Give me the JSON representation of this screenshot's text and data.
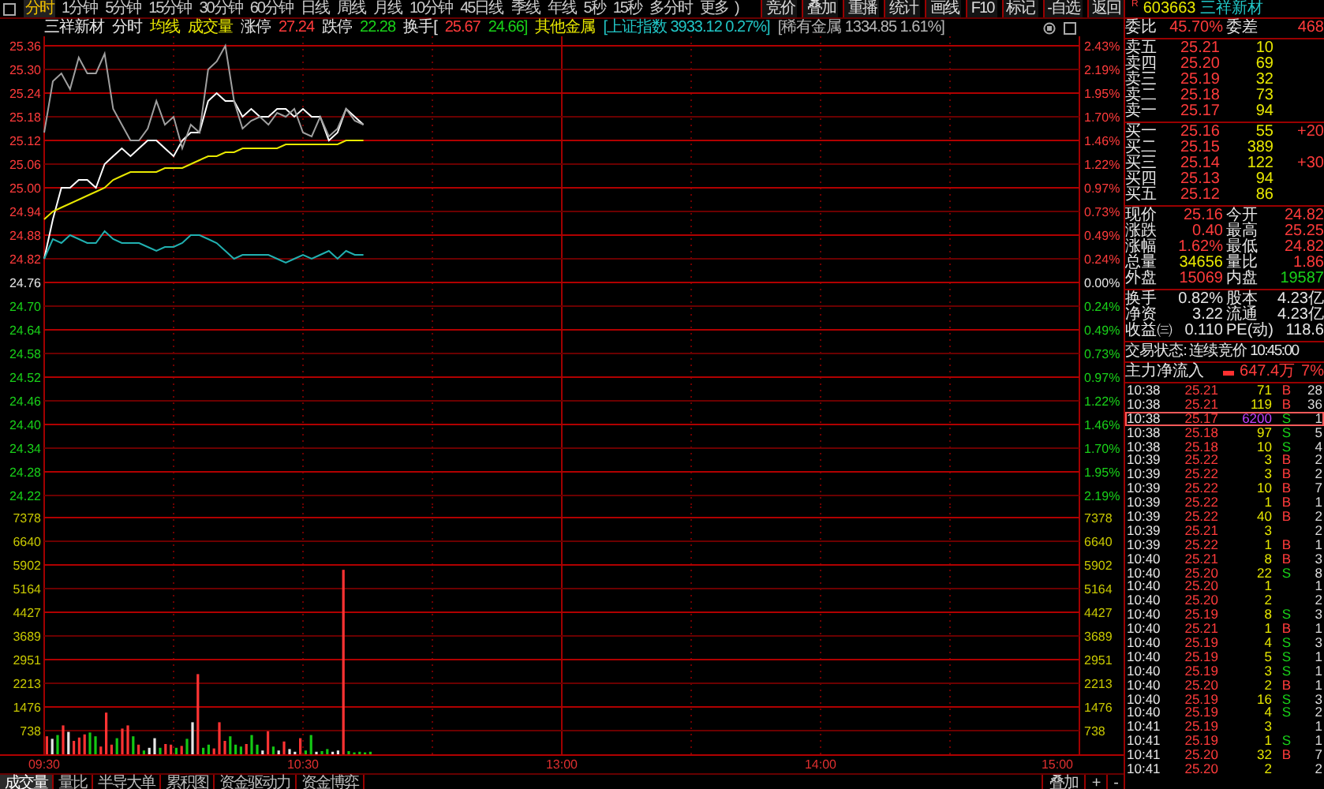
{
  "toolbar": {
    "periods": [
      {
        "label": "分时",
        "selected": true
      },
      {
        "label": "1分钟",
        "selected": false
      },
      {
        "label": "5分钟",
        "selected": false
      },
      {
        "label": "15分钟",
        "selected": false
      },
      {
        "label": "30分钟",
        "selected": false
      },
      {
        "label": "60分钟",
        "selected": false
      },
      {
        "label": "日线",
        "selected": false
      },
      {
        "label": "周线",
        "selected": false
      },
      {
        "label": "月线",
        "selected": false
      },
      {
        "label": "10分钟",
        "selected": false
      },
      {
        "label": "45日线",
        "selected": false
      },
      {
        "label": "季线",
        "selected": false
      },
      {
        "label": "年线",
        "selected": false
      },
      {
        "label": "5秒",
        "selected": false
      },
      {
        "label": "15秒",
        "selected": false
      },
      {
        "label": "多分时",
        "selected": false
      },
      {
        "label": "更多",
        "selected": false
      }
    ],
    "trailing": ")",
    "tools": [
      "竞价",
      "叠加",
      "重播",
      "统计",
      "画线",
      "F10",
      "标记",
      "-自选",
      "返回"
    ]
  },
  "info_bar": {
    "items": [
      {
        "text": "三祥新材",
        "color": "#e6e6e6"
      },
      {
        "text": "分时",
        "color": "#e6e6e6"
      },
      {
        "text": "均线",
        "color": "#e8e800"
      },
      {
        "text": "成交量",
        "color": "#e8e800"
      },
      {
        "text": "涨停",
        "color": "#e6e6e6"
      },
      {
        "text": "27.24",
        "color": "#ff3b3b"
      },
      {
        "text": "跌停",
        "color": "#e6e6e6"
      },
      {
        "text": "22.28",
        "color": "#19d219"
      },
      {
        "text": "换手[",
        "color": "#e6e6e6"
      },
      {
        "text": "25.67",
        "color": "#ff3b3b"
      },
      {
        "text": "24.66]",
        "color": "#19d219"
      },
      {
        "text": "其他金属",
        "color": "#e8e800"
      },
      {
        "text": "[上证指数 3933.12 0.27%]",
        "color": "#21c6c6"
      },
      {
        "text": "[稀有金属 1334.85 1.61%]",
        "color": "#b4b4b4"
      }
    ]
  },
  "price_panel": {
    "right_axis": [
      {
        "text": "2.43%",
        "color": "#ff3b3b"
      },
      {
        "text": "2.19%",
        "color": "#ff3b3b"
      },
      {
        "text": "1.95%",
        "color": "#ff3b3b"
      },
      {
        "text": "1.70%",
        "color": "#ff3b3b"
      },
      {
        "text": "1.46%",
        "color": "#ff3b3b"
      },
      {
        "text": "1.22%",
        "color": "#ff3b3b"
      },
      {
        "text": "0.97%",
        "color": "#ff3b3b"
      },
      {
        "text": "0.73%",
        "color": "#ff3b3b"
      },
      {
        "text": "0.49%",
        "color": "#ff3b3b"
      },
      {
        "text": "0.24%",
        "color": "#ff3b3b"
      },
      {
        "text": "0.00%",
        "color": "#e6e6e6"
      },
      {
        "text": "0.24%",
        "color": "#19d219"
      },
      {
        "text": "0.49%",
        "color": "#19d219"
      },
      {
        "text": "0.73%",
        "color": "#19d219"
      },
      {
        "text": "0.97%",
        "color": "#19d219"
      },
      {
        "text": "1.22%",
        "color": "#19d219"
      },
      {
        "text": "1.46%",
        "color": "#19d219"
      },
      {
        "text": "1.70%",
        "color": "#19d219"
      },
      {
        "text": "1.95%",
        "color": "#19d219"
      },
      {
        "text": "2.19%",
        "color": "#19d219"
      }
    ],
    "chart_data": {
      "type": "line",
      "grid": true,
      "ylim": [
        24.22,
        25.36
      ],
      "yticks": [
        {
          "value": 25.36,
          "label": "25.36"
        },
        {
          "value": 25.3,
          "label": "25.30"
        },
        {
          "value": 25.24,
          "label": "25.24"
        },
        {
          "value": 25.18,
          "label": "25.18"
        },
        {
          "value": 25.12,
          "label": "25.12"
        },
        {
          "value": 25.06,
          "label": "25.06"
        },
        {
          "value": 25.0,
          "label": "25.00"
        },
        {
          "value": 24.94,
          "label": "24.94"
        },
        {
          "value": 24.88,
          "label": "24.88"
        },
        {
          "value": 24.82,
          "label": "24.82"
        },
        {
          "value": 24.76,
          "label": "24.76"
        },
        {
          "value": 24.7,
          "label": "24.70"
        },
        {
          "value": 24.64,
          "label": "24.64"
        },
        {
          "value": 24.58,
          "label": "24.58"
        },
        {
          "value": 24.52,
          "label": "24.52"
        },
        {
          "value": 24.46,
          "label": "24.46"
        },
        {
          "value": 24.4,
          "label": "24.40"
        },
        {
          "value": 24.34,
          "label": "24.34"
        },
        {
          "value": 24.28,
          "label": "24.28"
        },
        {
          "value": 24.22,
          "label": "24.22"
        }
      ],
      "categories": [
        null,
        null,
        null,
        null,
        null,
        null,
        null,
        null,
        null,
        null,
        null,
        null,
        null,
        null,
        null,
        null,
        null,
        null,
        null,
        null,
        null,
        null,
        null,
        null,
        null,
        null,
        null,
        null,
        null,
        null,
        null,
        null,
        null,
        null,
        null,
        null,
        null,
        null,
        null,
        null,
        null,
        null,
        null,
        null,
        null,
        null,
        null,
        null,
        null,
        null,
        null,
        null,
        null,
        null,
        null,
        null,
        null,
        null,
        null,
        null,
        null,
        null,
        null,
        null,
        null,
        null,
        null,
        null,
        null,
        null,
        null,
        null,
        null,
        null,
        null,
        null,
        null,
        null,
        null,
        null,
        null,
        null,
        null,
        null,
        null,
        null,
        null,
        null,
        null,
        null,
        null,
        null,
        null,
        null,
        null,
        null,
        null,
        null,
        null,
        null,
        null,
        null,
        null,
        null,
        null,
        null,
        null,
        null,
        null,
        null,
        null,
        null,
        null,
        null,
        null,
        null,
        null,
        null,
        null,
        null,
        null
      ],
      "series": [
        {
          "color": "#ffffff",
          "values": [
            24.82,
            24.92,
            25.0,
            25.0,
            25.02,
            25.02,
            25.0,
            25.06,
            25.08,
            25.1,
            25.08,
            25.1,
            25.12,
            25.12,
            25.1,
            25.08,
            25.12,
            25.14,
            25.14,
            25.22,
            25.24,
            25.22,
            25.22,
            25.18,
            25.2,
            25.18,
            25.18,
            25.2,
            25.2,
            25.18,
            25.2,
            25.18,
            25.18,
            25.12,
            25.14,
            25.2,
            25.18,
            25.16,
            null,
            null,
            null,
            null,
            null,
            null,
            null,
            null,
            null,
            null,
            null,
            null,
            null,
            null,
            null,
            null,
            null,
            null,
            null,
            null,
            null,
            null,
            null,
            null,
            null,
            null,
            null,
            null,
            null,
            null,
            null,
            null,
            null,
            null,
            null,
            null,
            null,
            null,
            null,
            null,
            null,
            null,
            null,
            null,
            null,
            null,
            null,
            null,
            null,
            null,
            null,
            null,
            null,
            null,
            null,
            null,
            null,
            null,
            null,
            null,
            null,
            null,
            null,
            null,
            null,
            null,
            null,
            null,
            null,
            null,
            null,
            null,
            null,
            null,
            null,
            null,
            null,
            null,
            null,
            null,
            null,
            null,
            null
          ]
        },
        {
          "color": "#e8e800",
          "values": [
            24.92,
            24.94,
            24.95,
            24.96,
            24.97,
            24.98,
            24.99,
            25.0,
            25.02,
            25.03,
            25.04,
            25.04,
            25.04,
            25.04,
            25.05,
            25.05,
            25.05,
            25.06,
            25.07,
            25.08,
            25.08,
            25.09,
            25.09,
            25.1,
            25.1,
            25.1,
            25.1,
            25.1,
            25.11,
            25.11,
            25.11,
            25.11,
            25.11,
            25.11,
            25.11,
            25.12,
            25.12,
            25.12,
            null,
            null,
            null,
            null,
            null,
            null,
            null,
            null,
            null,
            null,
            null,
            null,
            null,
            null,
            null,
            null,
            null,
            null,
            null,
            null,
            null,
            null,
            null,
            null,
            null,
            null,
            null,
            null,
            null,
            null,
            null,
            null,
            null,
            null,
            null,
            null,
            null,
            null,
            null,
            null,
            null,
            null,
            null,
            null,
            null,
            null,
            null,
            null,
            null,
            null,
            null,
            null,
            null,
            null,
            null,
            null,
            null,
            null,
            null,
            null,
            null,
            null,
            null,
            null,
            null,
            null,
            null,
            null,
            null,
            null,
            null,
            null,
            null,
            null,
            null,
            null,
            null,
            null,
            null,
            null,
            null,
            null,
            null
          ]
        },
        {
          "color": "#a0a0a0",
          "values": [
            25.14,
            25.27,
            25.29,
            25.25,
            25.33,
            25.29,
            25.29,
            25.34,
            25.2,
            25.16,
            25.12,
            25.12,
            25.15,
            25.22,
            25.16,
            25.18,
            25.1,
            25.16,
            25.14,
            25.3,
            25.32,
            25.36,
            25.22,
            25.15,
            25.17,
            25.18,
            25.16,
            25.19,
            25.18,
            25.2,
            25.14,
            25.13,
            25.18,
            25.13,
            25.15,
            25.2,
            25.17,
            25.16,
            null,
            null,
            null,
            null,
            null,
            null,
            null,
            null,
            null,
            null,
            null,
            null,
            null,
            null,
            null,
            null,
            null,
            null,
            null,
            null,
            null,
            null,
            null,
            null,
            null,
            null,
            null,
            null,
            null,
            null,
            null,
            null,
            null,
            null,
            null,
            null,
            null,
            null,
            null,
            null,
            null,
            null,
            null,
            null,
            null,
            null,
            null,
            null,
            null,
            null,
            null,
            null,
            null,
            null,
            null,
            null,
            null,
            null,
            null,
            null,
            null,
            null,
            null,
            null,
            null,
            null,
            null,
            null,
            null,
            null,
            null,
            null,
            null,
            null,
            null,
            null,
            null,
            null,
            null,
            null,
            null,
            null,
            null
          ]
        },
        {
          "color": "#21b0b0",
          "values": [
            24.82,
            24.87,
            24.86,
            24.88,
            24.87,
            24.86,
            24.86,
            24.89,
            24.87,
            24.86,
            24.86,
            24.86,
            24.85,
            24.84,
            24.85,
            24.85,
            24.86,
            24.88,
            24.88,
            24.87,
            24.86,
            24.84,
            24.82,
            24.83,
            24.83,
            24.83,
            24.83,
            24.82,
            24.81,
            24.82,
            24.83,
            24.82,
            24.83,
            24.84,
            24.82,
            24.84,
            24.83,
            24.83,
            null,
            null,
            null,
            null,
            null,
            null,
            null,
            null,
            null,
            null,
            null,
            null,
            null,
            null,
            null,
            null,
            null,
            null,
            null,
            null,
            null,
            null,
            null,
            null,
            null,
            null,
            null,
            null,
            null,
            null,
            null,
            null,
            null,
            null,
            null,
            null,
            null,
            null,
            null,
            null,
            null,
            null,
            null,
            null,
            null,
            null,
            null,
            null,
            null,
            null,
            null,
            null,
            null,
            null,
            null,
            null,
            null,
            null,
            null,
            null,
            null,
            null,
            null,
            null,
            null,
            null,
            null,
            null,
            null,
            null,
            null,
            null,
            null,
            null,
            null,
            null,
            null,
            null,
            null,
            null,
            null,
            null,
            null
          ]
        }
      ]
    }
  },
  "volume_panel": {
    "time_labels": [
      "09:30",
      "10:30",
      "13:00",
      "14:00",
      "15:00"
    ],
    "right_axis": [
      "7378",
      "6640",
      "5902",
      "5164",
      "4427",
      "3689",
      "2951",
      "2213",
      "1476",
      "738"
    ],
    "chart_data": {
      "type": "bar",
      "grid": true,
      "ylim": [
        0,
        7378
      ],
      "yticks": [
        7378,
        6640,
        5902,
        5164,
        4427,
        3689,
        2951,
        2213,
        1476,
        738
      ],
      "categories": [
        null,
        null,
        null,
        null,
        null,
        null,
        null,
        null,
        null,
        null,
        null,
        null,
        null,
        null,
        null,
        null,
        null,
        null,
        null,
        null,
        null,
        null,
        null,
        null,
        null,
        null,
        null,
        null,
        null,
        null,
        null,
        null,
        null,
        null,
        null,
        null,
        null,
        null,
        null,
        null,
        null,
        null,
        null,
        null,
        null,
        null,
        null,
        null,
        null,
        null,
        null,
        null,
        null,
        null,
        null,
        null,
        null,
        null,
        null,
        null,
        null,
        null,
        null,
        null,
        null,
        null,
        null,
        null,
        null,
        null,
        null,
        null,
        null,
        null,
        null,
        null,
        null,
        null,
        null,
        null,
        null,
        null,
        null,
        null,
        null,
        null,
        null,
        null,
        null,
        null,
        null,
        null,
        null,
        null,
        null,
        null,
        null,
        null,
        null,
        null,
        null,
        null,
        null,
        null,
        null,
        null,
        null,
        null,
        null,
        null,
        null,
        null,
        null,
        null,
        null,
        null,
        null,
        null,
        null,
        null,
        null,
        null,
        null,
        null,
        null,
        null,
        null,
        null,
        null,
        null,
        null,
        null,
        null,
        null,
        null,
        null,
        null,
        null,
        null,
        null,
        null,
        null,
        null,
        null,
        null,
        null,
        null,
        null,
        null,
        null,
        null,
        null,
        null,
        null,
        null,
        null,
        null,
        null,
        null,
        null,
        null,
        null,
        null,
        null,
        null,
        null,
        null,
        null,
        null,
        null,
        null,
        null,
        null,
        null,
        null,
        null,
        null,
        null,
        null,
        null,
        null,
        null,
        null,
        null,
        null,
        null,
        null,
        null,
        null,
        null,
        null,
        null
      ],
      "series": [
        {
          "color": "#ff3333",
          "values": [
            560,
            null,
            null,
            900,
            null,
            420,
            520,
            620,
            null,
            null,
            240,
            1300,
            300,
            null,
            800,
            900,
            null,
            300,
            null,
            null,
            null,
            null,
            320,
            300,
            null,
            260,
            null,
            null,
            2500,
            null,
            null,
            180,
            1000,
            420,
            null,
            null,
            null,
            320,
            null,
            null,
            null,
            720,
            null,
            null,
            400,
            null,
            null,
            500,
            null,
            null,
            null,
            null,
            null,
            null,
            null,
            5750,
            null,
            null,
            null,
            null,
            null,
            null,
            null,
            null,
            null,
            null,
            null,
            null,
            null,
            null,
            null,
            null,
            null,
            null,
            null,
            null,
            null,
            null,
            null,
            null,
            null,
            null,
            null,
            null,
            null,
            null,
            null,
            null,
            null,
            null,
            null,
            null,
            null,
            null,
            null,
            null,
            null,
            null,
            null,
            null,
            null,
            null,
            null,
            null,
            null,
            null,
            null,
            null,
            null,
            null,
            null,
            null,
            null,
            null,
            null,
            null,
            null,
            null,
            null,
            null,
            null,
            null,
            null,
            null,
            null,
            null,
            null,
            null,
            null,
            null,
            null,
            null,
            null,
            null,
            null,
            null,
            null,
            null,
            null,
            null,
            null,
            null,
            null,
            null,
            null,
            null,
            null,
            null,
            null,
            null,
            null,
            null,
            null,
            null,
            null,
            null,
            null,
            null,
            null,
            null,
            null,
            null,
            null,
            null,
            null,
            null,
            null,
            null,
            null,
            null,
            null,
            null,
            null,
            null,
            null,
            null,
            null,
            null,
            null,
            null,
            null,
            null,
            null,
            null,
            null,
            null,
            null,
            null,
            null,
            null,
            null,
            null
          ]
        },
        {
          "color": "#14c814",
          "values": [
            null,
            null,
            600,
            null,
            null,
            null,
            null,
            null,
            680,
            560,
            null,
            null,
            null,
            500,
            null,
            null,
            560,
            null,
            120,
            null,
            null,
            200,
            null,
            null,
            200,
            null,
            480,
            null,
            null,
            200,
            300,
            null,
            null,
            null,
            560,
            300,
            240,
            null,
            600,
            300,
            null,
            null,
            240,
            null,
            null,
            null,
            null,
            null,
            120,
            600,
            null,
            100,
            160,
            null,
            null,
            null,
            100,
            60,
            80,
            60,
            80,
            null,
            null,
            null,
            null,
            null,
            null,
            null,
            null,
            null,
            null,
            null,
            null,
            null,
            null,
            null,
            null,
            null,
            null,
            null,
            null,
            null,
            null,
            null,
            null,
            null,
            null,
            null,
            null,
            null,
            null,
            null,
            null,
            null,
            null,
            null,
            null,
            null,
            null,
            null,
            null,
            null,
            null,
            null,
            null,
            null,
            null,
            null,
            null,
            null,
            null,
            null,
            null,
            null,
            null,
            null,
            null,
            null,
            null,
            null,
            null,
            null,
            null,
            null,
            null,
            null,
            null,
            null,
            null,
            null,
            null,
            null,
            null,
            null,
            null,
            null,
            null,
            null,
            null,
            null,
            null,
            null,
            null,
            null,
            null,
            null,
            null,
            null,
            null,
            null,
            null,
            null,
            null,
            null,
            null,
            null,
            null,
            null,
            null,
            null,
            null,
            null,
            null,
            null,
            null,
            null,
            null,
            null,
            null,
            null,
            null,
            null,
            null,
            null,
            null,
            null,
            null,
            null,
            null,
            null,
            null,
            null,
            null,
            null,
            null,
            null,
            null,
            null,
            null,
            null,
            null,
            null
          ]
        },
        {
          "color": "#e6e6e6",
          "values": [
            null,
            480,
            null,
            null,
            700,
            null,
            null,
            null,
            null,
            null,
            null,
            null,
            null,
            null,
            null,
            null,
            null,
            null,
            null,
            200,
            500,
            null,
            null,
            null,
            null,
            null,
            null,
            1000,
            null,
            null,
            null,
            null,
            null,
            null,
            null,
            null,
            null,
            null,
            null,
            null,
            120,
            null,
            null,
            120,
            null,
            160,
            80,
            null,
            null,
            null,
            80,
            null,
            null,
            80,
            120,
            null,
            null,
            null,
            null,
            null,
            null,
            null,
            null,
            null,
            null,
            null,
            null,
            null,
            null,
            null,
            null,
            null,
            null,
            null,
            null,
            null,
            null,
            null,
            null,
            null,
            null,
            null,
            null,
            null,
            null,
            null,
            null,
            null,
            null,
            null,
            null,
            null,
            null,
            null,
            null,
            null,
            null,
            null,
            null,
            null,
            null,
            null,
            null,
            null,
            null,
            null,
            null,
            null,
            null,
            null,
            null,
            null,
            null,
            null,
            null,
            null,
            null,
            null,
            null,
            null,
            null,
            null,
            null,
            null,
            null,
            null,
            null,
            null,
            null,
            null,
            null,
            null,
            null,
            null,
            null,
            null,
            null,
            null,
            null,
            null,
            null,
            null,
            null,
            null,
            null,
            null,
            null,
            null,
            null,
            null,
            null,
            null,
            null,
            null,
            null,
            null,
            null,
            null,
            null,
            null,
            null,
            null,
            null,
            null,
            null,
            null,
            null,
            null,
            null,
            null,
            null,
            null,
            null,
            null,
            null,
            null,
            null,
            null,
            null,
            null,
            null,
            null,
            null,
            null,
            null,
            null,
            null,
            null,
            null,
            null,
            null,
            null
          ]
        }
      ]
    }
  },
  "bottom_bar": {
    "tabs": [
      {
        "label": "成交量",
        "selected": true
      },
      {
        "label": "量比",
        "selected": false
      },
      {
        "label": "半导大单",
        "selected": false
      },
      {
        "label": "累积图",
        "selected": false
      },
      {
        "label": "资金驱动力",
        "selected": false
      },
      {
        "label": "资金博弈",
        "selected": false
      }
    ],
    "tools": [
      "叠加",
      "+",
      "-"
    ]
  },
  "quote": {
    "badge": "R",
    "code": "603663",
    "name": "三祥新材",
    "summary": [
      {
        "label": "委比",
        "value": "45.70%",
        "color": "#ff3b3b"
      },
      {
        "label": "委差",
        "value": "468",
        "color": "#ff3b3b"
      }
    ],
    "asks": [
      {
        "label": "卖五",
        "price": "25.21",
        "volume": "10"
      },
      {
        "label": "卖四",
        "price": "25.20",
        "volume": "69"
      },
      {
        "label": "卖三",
        "price": "25.19",
        "volume": "32"
      },
      {
        "label": "卖二",
        "price": "25.18",
        "volume": "73"
      },
      {
        "label": "卖一",
        "price": "25.17",
        "volume": "94"
      }
    ],
    "bids": [
      {
        "label": "买一",
        "price": "25.16",
        "volume": "55",
        "change": "+20"
      },
      {
        "label": "买二",
        "price": "25.15",
        "volume": "389"
      },
      {
        "label": "买三",
        "price": "25.14",
        "volume": "122",
        "change": "+30"
      },
      {
        "label": "买四",
        "price": "25.13",
        "volume": "94"
      },
      {
        "label": "买五",
        "price": "25.12",
        "volume": "86"
      }
    ],
    "stats": [
      [
        {
          "label": "现价",
          "value": "25.16",
          "color": "#ff3b3b"
        },
        {
          "label": "今开",
          "value": "24.82",
          "color": "#ff3b3b"
        }
      ],
      [
        {
          "label": "涨跌",
          "value": "0.40",
          "color": "#ff3b3b"
        },
        {
          "label": "最高",
          "value": "25.25",
          "color": "#ff3b3b"
        }
      ],
      [
        {
          "label": "涨幅",
          "value": "1.62%",
          "color": "#ff3b3b"
        },
        {
          "label": "最低",
          "value": "24.82",
          "color": "#ff3b3b"
        }
      ],
      [
        {
          "label": "总量",
          "value": "34656",
          "color": "#e8e800"
        },
        {
          "label": "量比",
          "value": "1.86",
          "color": "#ff3b3b"
        }
      ],
      [
        {
          "label": "外盘",
          "value": "15069",
          "color": "#ff3b3b"
        },
        {
          "label": "内盘",
          "value": "19587",
          "color": "#19d219"
        }
      ]
    ],
    "fundamentals": [
      [
        {
          "label": "换手",
          "value": "0.82%",
          "color": "#e6e6e6"
        },
        {
          "label": "股本",
          "value": "4.23亿",
          "color": "#e6e6e6"
        }
      ],
      [
        {
          "label": "净资",
          "value": "3.22",
          "color": "#e6e6e6"
        },
        {
          "label": "流通",
          "value": "4.23亿",
          "color": "#e6e6e6"
        }
      ],
      [
        {
          "label": "收益㈢",
          "value": "0.110",
          "color": "#e6e6e6"
        },
        {
          "label": "PE(动)",
          "value": "118.6",
          "color": "#e6e6e6"
        }
      ]
    ],
    "status": "交易状态: 连续竞价 10:45:00",
    "flow": {
      "label": "主力净流入",
      "value": "647.4万",
      "percent": "7%"
    },
    "trades": [
      {
        "time": "10:38",
        "price": "25.21",
        "volume": "71",
        "side": "B",
        "kind": "buy",
        "count": "28",
        "highlighted": false
      },
      {
        "time": "10:38",
        "price": "25.21",
        "volume": "119",
        "side": "B",
        "kind": "buy",
        "count": "36",
        "highlighted": false
      },
      {
        "time": "10:38",
        "price": "25.17",
        "volume": "6200",
        "side": "S",
        "kind": "sell",
        "count": "1",
        "highlighted": true
      },
      {
        "time": "10:38",
        "price": "25.18",
        "volume": "97",
        "side": "S",
        "kind": "sell",
        "count": "5",
        "highlighted": false
      },
      {
        "time": "10:38",
        "price": "25.18",
        "volume": "10",
        "side": "S",
        "kind": "sell",
        "count": "4",
        "highlighted": false
      },
      {
        "time": "10:39",
        "price": "25.22",
        "volume": "3",
        "side": "B",
        "kind": "buy",
        "count": "2",
        "highlighted": false
      },
      {
        "time": "10:39",
        "price": "25.22",
        "volume": "3",
        "side": "B",
        "kind": "buy",
        "count": "2",
        "highlighted": false
      },
      {
        "time": "10:39",
        "price": "25.22",
        "volume": "10",
        "side": "B",
        "kind": "buy",
        "count": "7",
        "highlighted": false
      },
      {
        "time": "10:39",
        "price": "25.22",
        "volume": "1",
        "side": "B",
        "kind": "buy",
        "count": "1",
        "highlighted": false
      },
      {
        "time": "10:39",
        "price": "25.22",
        "volume": "40",
        "side": "B",
        "kind": "buy",
        "count": "2",
        "highlighted": false
      },
      {
        "time": "10:39",
        "price": "25.21",
        "volume": "3",
        "kind": "neutral",
        "count": "2",
        "highlighted": false
      },
      {
        "time": "10:39",
        "price": "25.22",
        "volume": "1",
        "side": "B",
        "kind": "buy",
        "count": "1",
        "highlighted": false
      },
      {
        "time": "10:40",
        "price": "25.21",
        "volume": "8",
        "side": "B",
        "kind": "buy",
        "count": "3",
        "highlighted": false
      },
      {
        "time": "10:40",
        "price": "25.20",
        "volume": "22",
        "side": "S",
        "kind": "sell",
        "count": "8",
        "highlighted": false
      },
      {
        "time": "10:40",
        "price": "25.20",
        "volume": "1",
        "kind": "neutral",
        "count": "1",
        "highlighted": false
      },
      {
        "time": "10:40",
        "price": "25.20",
        "volume": "2",
        "kind": "neutral",
        "count": "2",
        "highlighted": false
      },
      {
        "time": "10:40",
        "price": "25.19",
        "volume": "8",
        "side": "S",
        "kind": "sell",
        "count": "3",
        "highlighted": false
      },
      {
        "time": "10:40",
        "price": "25.21",
        "volume": "1",
        "side": "B",
        "kind": "buy",
        "count": "1",
        "highlighted": false
      },
      {
        "time": "10:40",
        "price": "25.19",
        "volume": "4",
        "side": "S",
        "kind": "sell",
        "count": "3",
        "highlighted": false
      },
      {
        "time": "10:40",
        "price": "25.19",
        "volume": "5",
        "side": "S",
        "kind": "sell",
        "count": "1",
        "highlighted": false
      },
      {
        "time": "10:40",
        "price": "25.19",
        "volume": "3",
        "side": "S",
        "kind": "sell",
        "count": "1",
        "highlighted": false
      },
      {
        "time": "10:40",
        "price": "25.20",
        "volume": "2",
        "side": "B",
        "kind": "buy",
        "count": "1",
        "highlighted": false
      },
      {
        "time": "10:40",
        "price": "25.19",
        "volume": "16",
        "side": "S",
        "kind": "sell",
        "count": "3",
        "highlighted": false
      },
      {
        "time": "10:40",
        "price": "25.19",
        "volume": "4",
        "side": "S",
        "kind": "sell",
        "count": "2",
        "highlighted": false
      },
      {
        "time": "10:41",
        "price": "25.19",
        "volume": "3",
        "kind": "neutral",
        "count": "1",
        "highlighted": false
      },
      {
        "time": "10:41",
        "price": "25.19",
        "volume": "1",
        "side": "S",
        "kind": "sell",
        "count": "1",
        "highlighted": false
      },
      {
        "time": "10:41",
        "price": "25.20",
        "volume": "32",
        "side": "B",
        "kind": "buy",
        "count": "7",
        "highlighted": false
      },
      {
        "time": "10:41",
        "price": "25.20",
        "volume": "2",
        "kind": "neutral",
        "count": "2",
        "highlighted": false
      }
    ]
  }
}
